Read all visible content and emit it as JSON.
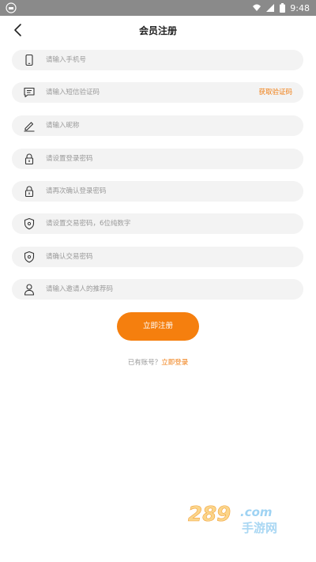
{
  "status_bar": {
    "time": "9:48"
  },
  "header": {
    "title": "会员注册"
  },
  "fields": [
    {
      "icon": "phone-icon",
      "placeholder": "请输入手机号"
    },
    {
      "icon": "message-icon",
      "placeholder": "请输入短信验证码",
      "action": "获取验证码"
    },
    {
      "icon": "pencil-icon",
      "placeholder": "请输入昵称"
    },
    {
      "icon": "lock-icon",
      "placeholder": "请设置登录密码"
    },
    {
      "icon": "lock-icon",
      "placeholder": "请再次确认登录密码"
    },
    {
      "icon": "shield-icon",
      "placeholder": "请设置交易密码，6位纯数字"
    },
    {
      "icon": "shield-icon",
      "placeholder": "请确认交易密码"
    },
    {
      "icon": "user-icon",
      "placeholder": "请输入邀请人的推荐码"
    }
  ],
  "submit_label": "立即注册",
  "login_prompt": {
    "text": "已有账号？",
    "link": "立即登录"
  },
  "watermark": {
    "brand": "289.com",
    "subtitle": "手游网"
  },
  "colors": {
    "accent": "#f57f0e",
    "field_bg": "#f3f3f3",
    "statusbar": "#8a8a8a"
  }
}
